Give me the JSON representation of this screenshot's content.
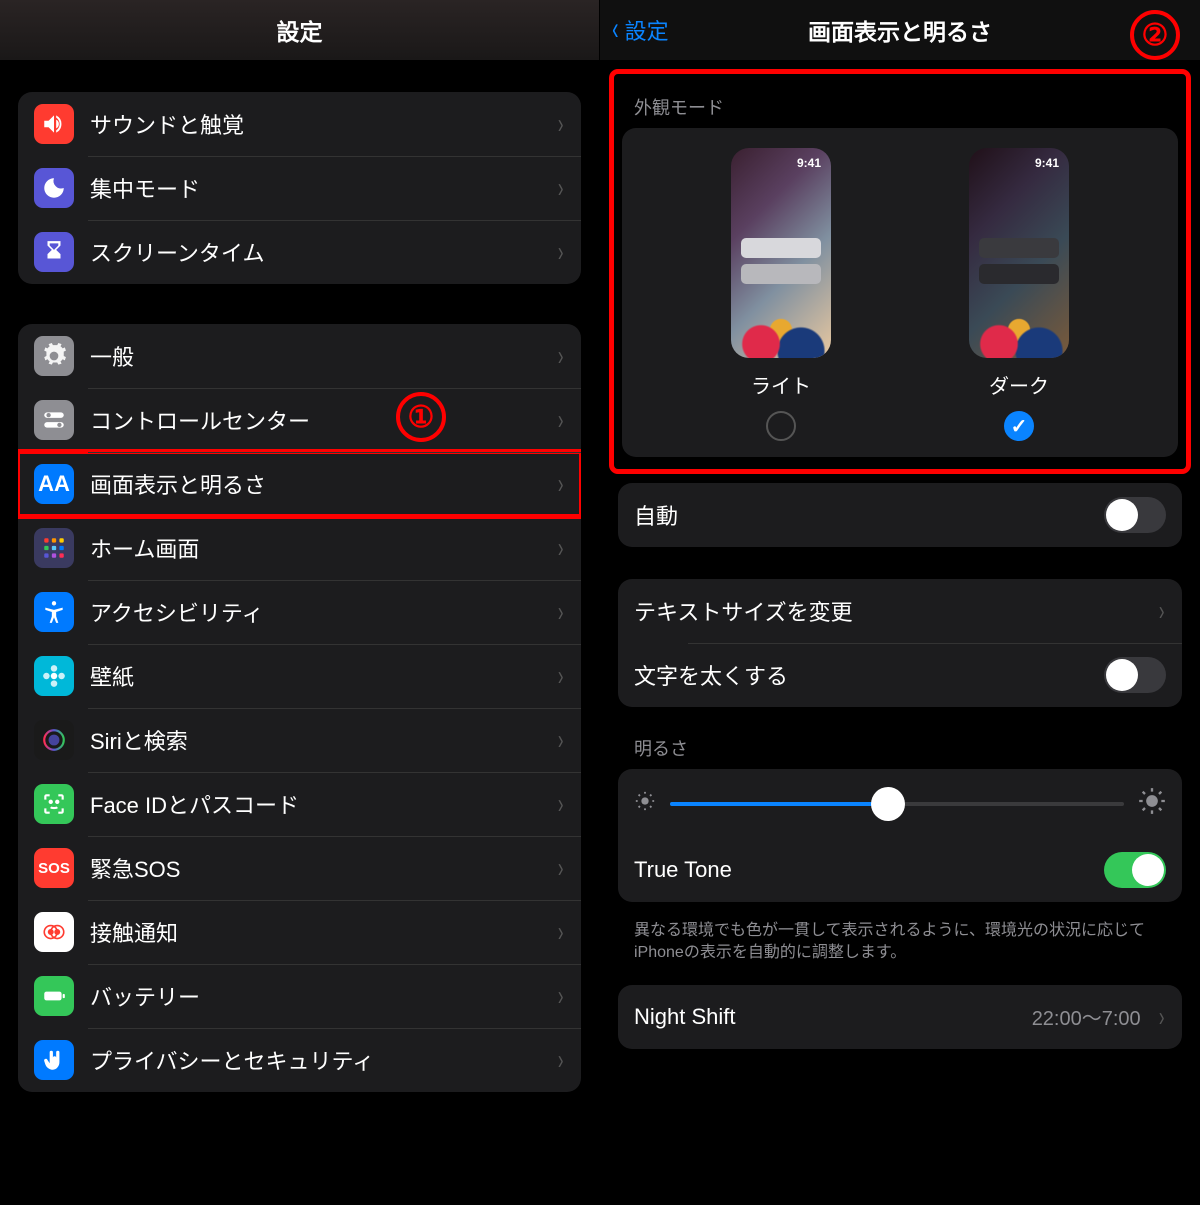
{
  "annotations": {
    "step1": "①",
    "step2": "②"
  },
  "left": {
    "title": "設定",
    "group1": [
      {
        "id": "sound",
        "label": "サウンドと触覚",
        "iconName": "speaker-icon"
      },
      {
        "id": "focus",
        "label": "集中モード",
        "iconName": "moon-icon"
      },
      {
        "id": "screentime",
        "label": "スクリーンタイム",
        "iconName": "hourglass-icon"
      }
    ],
    "group2": [
      {
        "id": "general",
        "label": "一般",
        "iconName": "gear-icon"
      },
      {
        "id": "controlcenter",
        "label": "コントロールセンター",
        "iconName": "switches-icon"
      },
      {
        "id": "display",
        "label": "画面表示と明るさ",
        "iconName": "text-size-icon",
        "highlight": true
      },
      {
        "id": "home",
        "label": "ホーム画面",
        "iconName": "apps-grid-icon"
      },
      {
        "id": "accessibility",
        "label": "アクセシビリティ",
        "iconName": "accessibility-icon"
      },
      {
        "id": "wallpaper",
        "label": "壁紙",
        "iconName": "flower-icon"
      },
      {
        "id": "siri",
        "label": "Siriと検索",
        "iconName": "siri-icon"
      },
      {
        "id": "faceid",
        "label": "Face IDとパスコード",
        "iconName": "face-id-icon"
      },
      {
        "id": "sos",
        "label": "緊急SOS",
        "iconName": "sos-icon"
      },
      {
        "id": "exposure",
        "label": "接触通知",
        "iconName": "exposure-icon"
      },
      {
        "id": "battery",
        "label": "バッテリー",
        "iconName": "battery-icon"
      },
      {
        "id": "privacy",
        "label": "プライバシーとセキュリティ",
        "iconName": "hand-icon"
      }
    ]
  },
  "right": {
    "back": "設定",
    "title": "画面表示と明るさ",
    "appearance_header": "外観モード",
    "preview_time": "9:41",
    "modes": {
      "light": {
        "label": "ライト",
        "checked": false
      },
      "dark": {
        "label": "ダーク",
        "checked": true
      }
    },
    "auto": {
      "label": "自動",
      "on": false
    },
    "text_size": "テキストサイズを変更",
    "bold_text": {
      "label": "文字を太くする",
      "on": false
    },
    "brightness_header": "明るさ",
    "brightness_value_pct": 48,
    "true_tone": {
      "label": "True Tone",
      "on": true
    },
    "true_tone_note": "異なる環境でも色が一貫して表示されるように、環境光の状況に応じてiPhoneの表示を自動的に調整します。",
    "night_shift": {
      "label": "Night Shift",
      "value": "22:00～7:00"
    }
  }
}
